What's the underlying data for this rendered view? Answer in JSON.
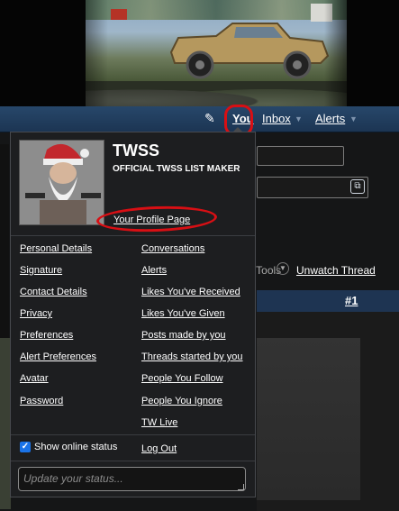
{
  "nav": {
    "you": "You",
    "inbox": "Inbox",
    "alerts": "Alerts",
    "edit_icon": "edit-icon"
  },
  "thread": {
    "tools": "Thread Tools",
    "unwatch": "Unwatch Thread",
    "post_number": "#1"
  },
  "user": {
    "name": "TWSS",
    "title": "OFFICIAL TWSS LIST MAKER",
    "profile_link": "Your Profile Page"
  },
  "menu": {
    "left": [
      "Personal Details",
      "Signature",
      "Contact Details",
      "Privacy",
      "Preferences",
      "Alert Preferences",
      "Avatar",
      "Password"
    ],
    "right": [
      "Conversations",
      "Alerts",
      "Likes You've Received",
      "Likes You've Given",
      "Posts made by you",
      "Threads started by you",
      "People You Follow",
      "People You Ignore",
      "TW Live"
    ],
    "show_online": "Show online status",
    "show_online_checked": true,
    "logout": "Log Out",
    "status_placeholder": "Update your status..."
  },
  "colors": {
    "navbar": "#1c3553",
    "menu_bg": "#1d1e20",
    "annotation_red": "#d80f14",
    "checkbox": "#1a73e8"
  }
}
